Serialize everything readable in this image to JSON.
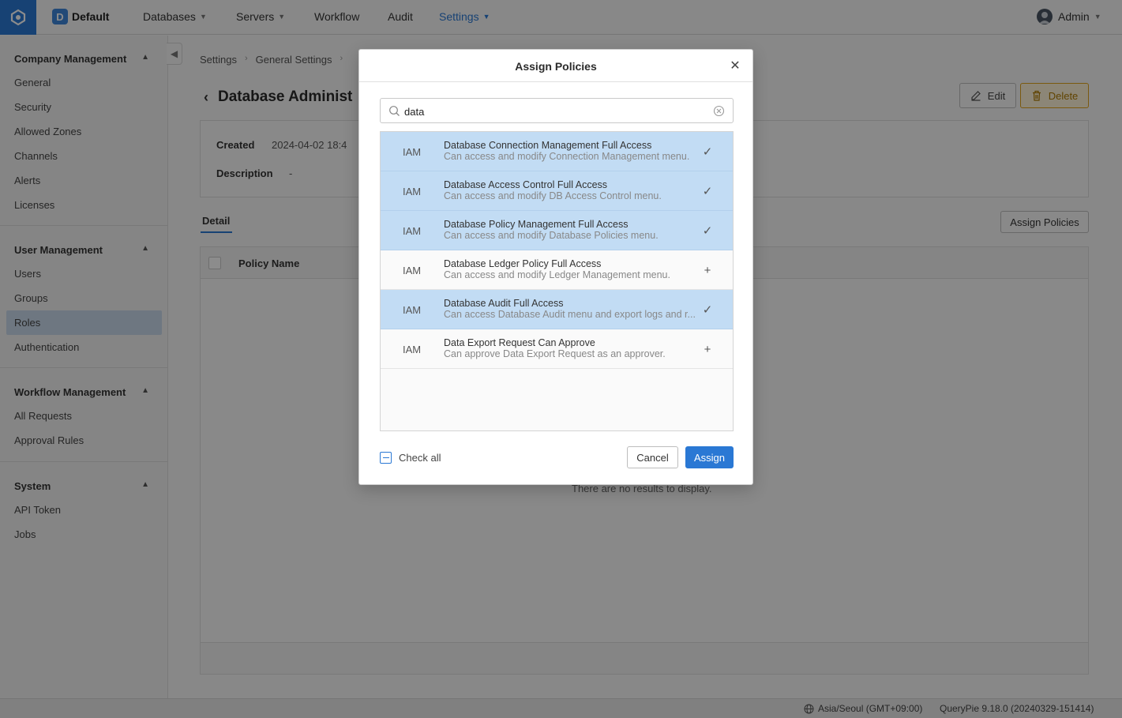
{
  "topbar": {
    "workspace_badge": "D",
    "workspace_name": "Default",
    "nav": [
      {
        "label": "Databases",
        "has_dropdown": true
      },
      {
        "label": "Servers",
        "has_dropdown": true
      },
      {
        "label": "Workflow",
        "has_dropdown": false
      },
      {
        "label": "Audit",
        "has_dropdown": false
      },
      {
        "label": "Settings",
        "has_dropdown": true,
        "active": true
      }
    ],
    "user": "Admin",
    "accent_color": "#2a78d4"
  },
  "sidebar": {
    "groups": [
      {
        "title": "Company Management",
        "items": [
          "General",
          "Security",
          "Allowed Zones",
          "Channels",
          "Alerts",
          "Licenses"
        ]
      },
      {
        "title": "User Management",
        "items": [
          "Users",
          "Groups",
          "Roles",
          "Authentication"
        ],
        "active_item": "Roles"
      },
      {
        "title": "Workflow Management",
        "items": [
          "All Requests",
          "Approval Rules"
        ]
      },
      {
        "title": "System",
        "items": [
          "API Token",
          "Jobs"
        ]
      }
    ]
  },
  "main": {
    "breadcrumb": [
      "Settings",
      "General Settings"
    ],
    "title": "Database Administ",
    "edit_label": "Edit",
    "delete_label": "Delete",
    "created_label": "Created",
    "created_value": "2024-04-02 18:4",
    "description_label": "Description",
    "description_value": "-",
    "tab_detail": "Detail",
    "assign_policies_label": "Assign Policies",
    "column_policy_name": "Policy Name",
    "empty_text": "There are no results to display."
  },
  "modal": {
    "title": "Assign Policies",
    "search_value": "data",
    "policies": [
      {
        "category": "IAM",
        "name": "Database Connection Management Full Access",
        "description": "Can access and modify Connection Management menu.",
        "selected": true
      },
      {
        "category": "IAM",
        "name": "Database Access Control Full Access",
        "description": "Can access and modify DB Access Control menu.",
        "selected": true
      },
      {
        "category": "IAM",
        "name": "Database Policy Management Full Access",
        "description": "Can access and modify Database Policies menu.",
        "selected": true
      },
      {
        "category": "IAM",
        "name": "Database Ledger Policy Full Access",
        "description": "Can access and modify Ledger Management menu.",
        "selected": false
      },
      {
        "category": "IAM",
        "name": "Database Audit Full Access",
        "description": "Can access Database Audit menu and export logs and r...",
        "selected": true
      },
      {
        "category": "IAM",
        "name": "Data Export Request Can Approve",
        "description": "Can approve Data Export Request as an approver.",
        "selected": false
      }
    ],
    "check_all_label": "Check all",
    "cancel_label": "Cancel",
    "assign_label": "Assign"
  },
  "status": {
    "timezone": "Asia/Seoul (GMT+09:00)",
    "version": "QueryPie 9.18.0 (20240329-151414)"
  }
}
